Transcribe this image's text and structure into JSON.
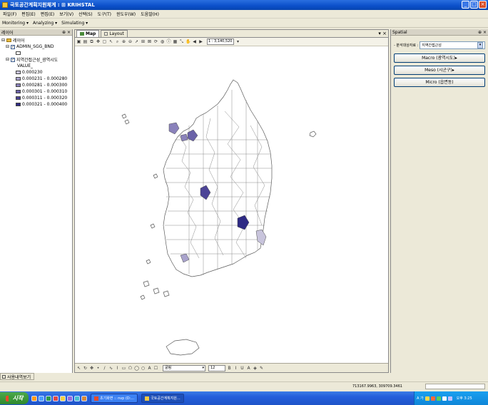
{
  "window": {
    "title": "국토공간계획지원체계 : ⊞ KRIHSTAL",
    "controls": [
      "_",
      "□",
      "×"
    ]
  },
  "menu": [
    "파일(F)",
    "편집(E)",
    "편집(E)",
    "보기(V)",
    "선택(S)",
    "도구(T)",
    "윈도우(W)",
    "도움말(H)"
  ],
  "modes": [
    "Monitoring ▾",
    "Analyzing ▾",
    "Simulating ▾"
  ],
  "layers_pane": {
    "title": "레이어",
    "controls": "⊕ ×",
    "group": "레이어",
    "layer1": "ADMIN_SGG_BND",
    "layer2": "지역간접근성_광역시도",
    "field": "VALUE_",
    "legend": [
      {
        "label": "0.000230",
        "color": "#c8c4dc"
      },
      {
        "label": "0.000231 - 0.000280",
        "color": "#a9a3cc"
      },
      {
        "label": "0.000281 - 0.000300",
        "color": "#8a82bb"
      },
      {
        "label": "0.000301 - 0.000310",
        "color": "#6a62a8"
      },
      {
        "label": "0.000311 - 0.000320",
        "color": "#4c4496"
      },
      {
        "label": "0.000321 - 0.000400",
        "color": "#2e2a84"
      }
    ],
    "bottom_tab": "사용내역보기"
  },
  "map": {
    "tabs": [
      "Map",
      "Layout"
    ],
    "tab_controls": "▾ ×",
    "scale": "1 : 3,140,520",
    "font": "굴림",
    "font_size": "12",
    "coordinates": "713167.9963, 309709.3461"
  },
  "spatial": {
    "title": "Spatial",
    "controls": "⊕ ×",
    "select_label": "- 분석대상자료 :",
    "select_value": "지역간접근성",
    "buttons": [
      "Macro (광역시도)▸",
      "Meso (시군구)▸",
      "Micro (읍면동)"
    ]
  },
  "taskbar": {
    "start": "시작",
    "tasks": [
      "초기화면 :: nvp (D:...",
      "국토공간계획지원..."
    ],
    "ime": "A 가",
    "clock": "오후 3:25"
  }
}
